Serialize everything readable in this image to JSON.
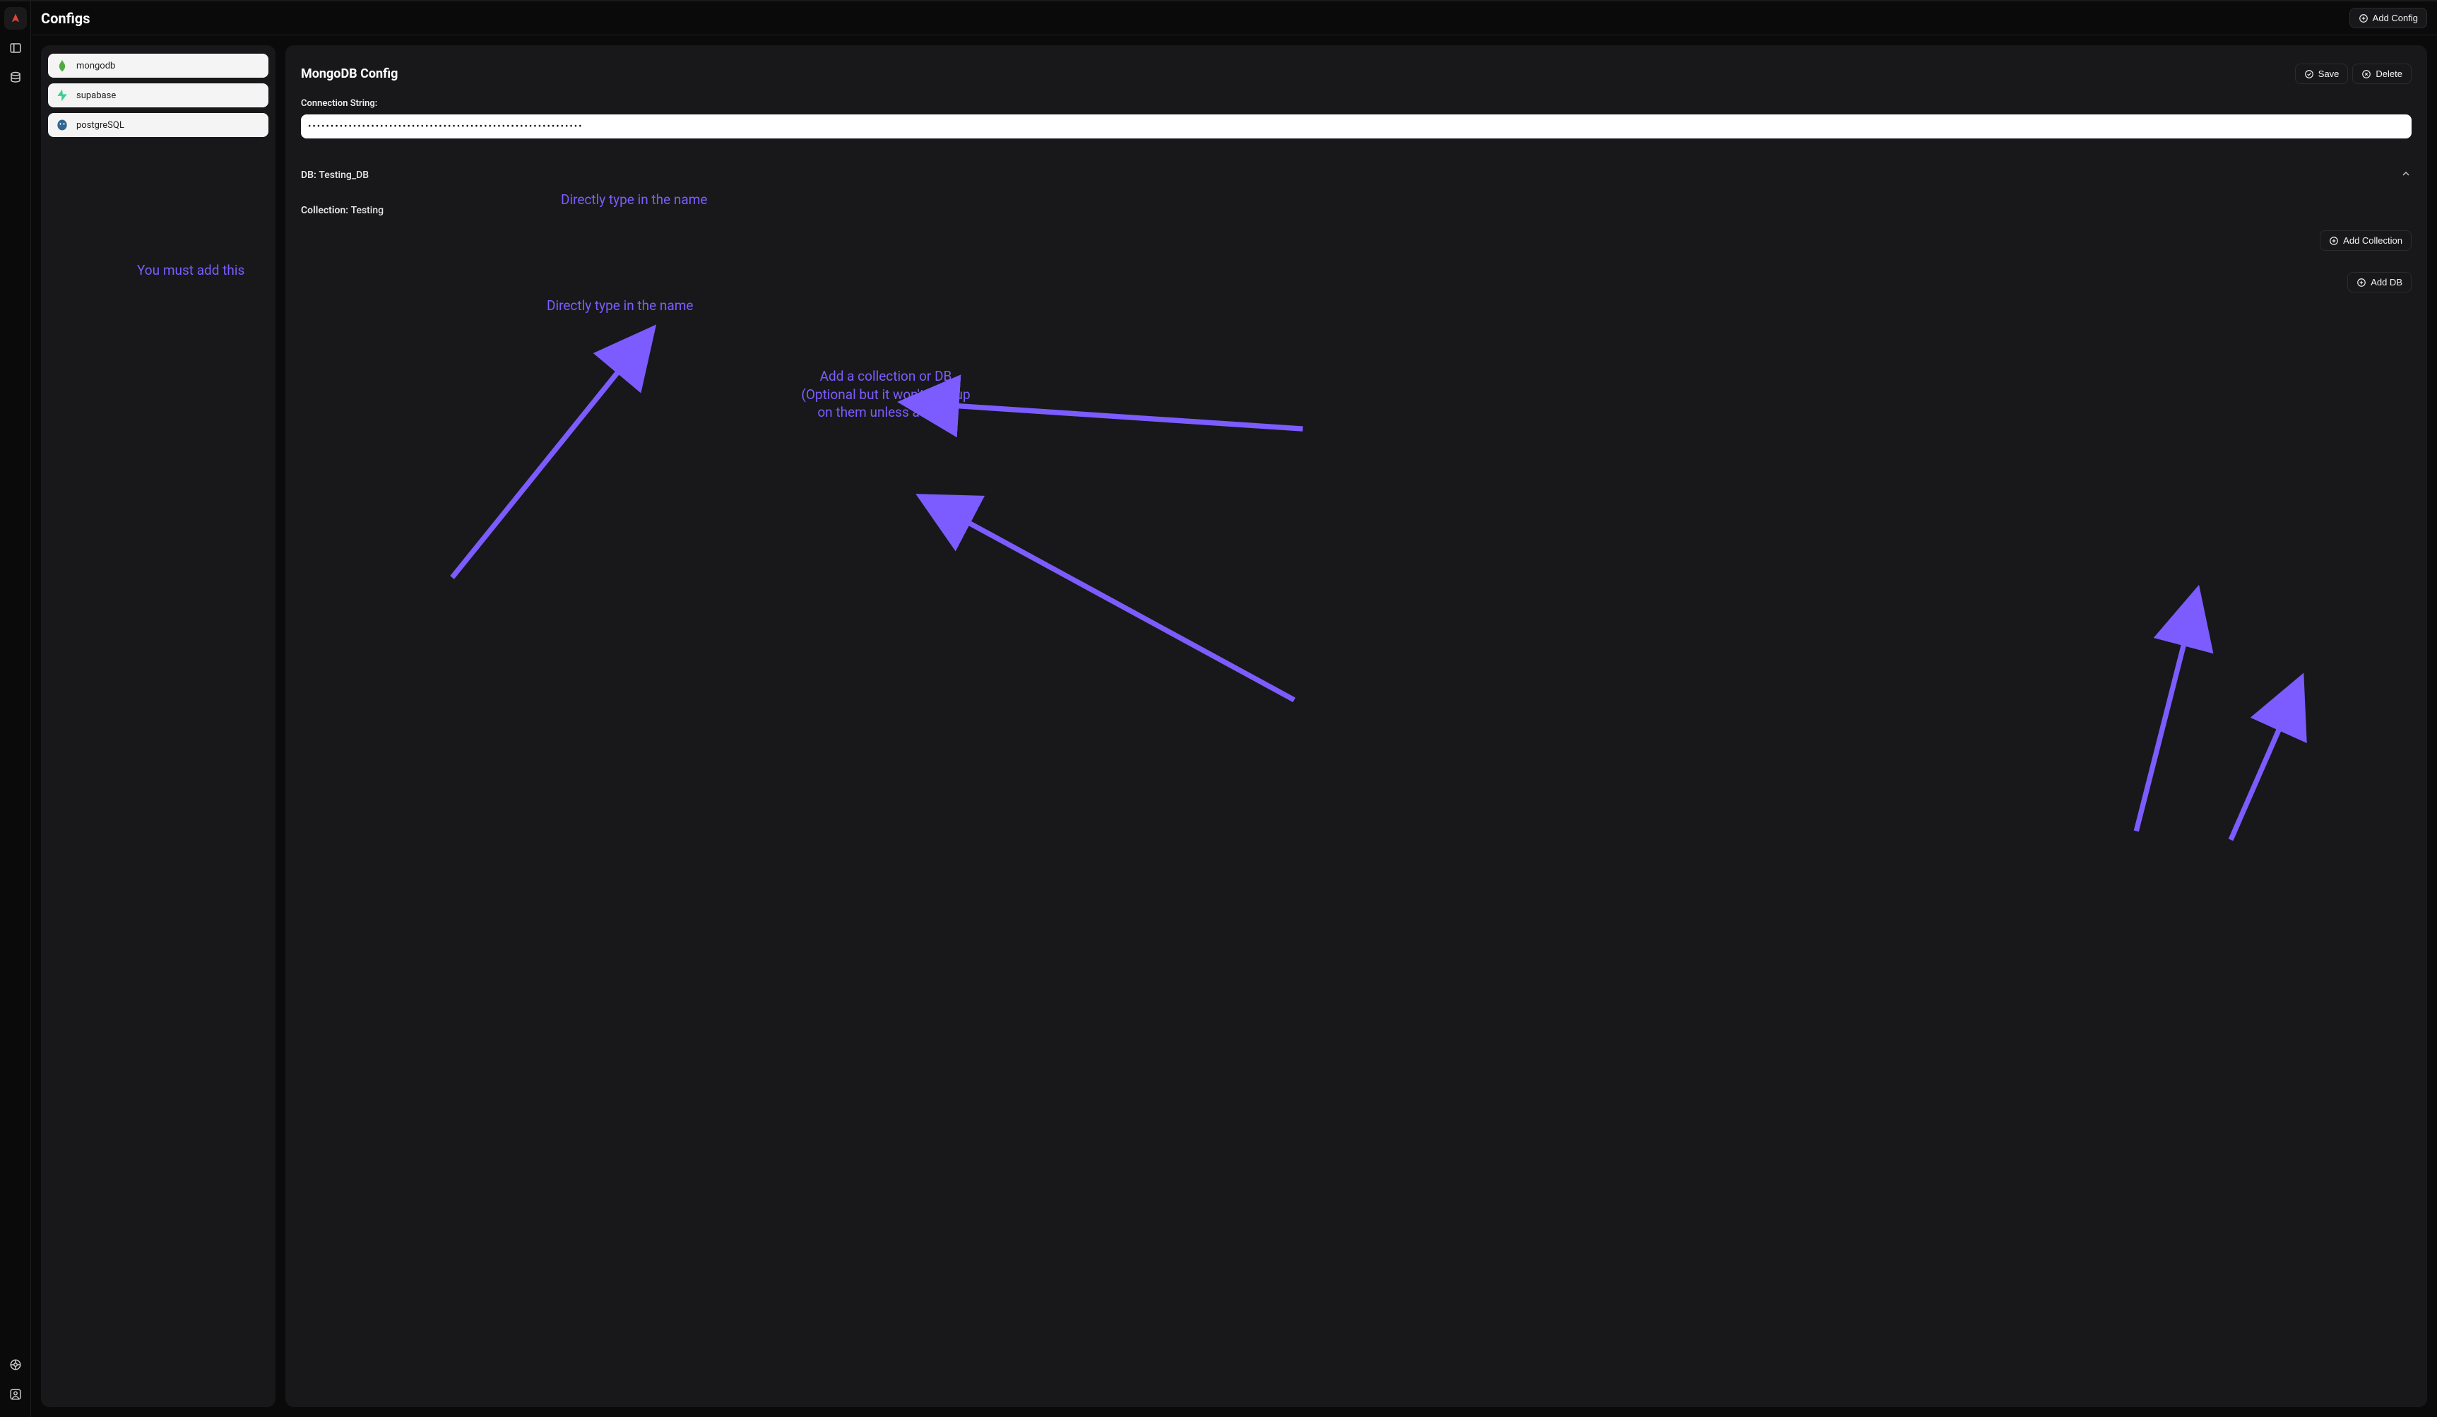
{
  "header": {
    "title": "Configs",
    "add_config_label": "Add Config"
  },
  "rail": {
    "logo": "app-logo",
    "items": [
      "panel-icon",
      "database-icon"
    ],
    "bottom_items": [
      "help-icon",
      "profile-icon"
    ]
  },
  "config_list": {
    "items": [
      {
        "id": "mongodb",
        "label": "mongodb",
        "icon": "mongodb"
      },
      {
        "id": "supabase",
        "label": "supabase",
        "icon": "supabase"
      },
      {
        "id": "postgresql",
        "label": "postgreSQL",
        "icon": "postgres"
      }
    ]
  },
  "detail": {
    "title": "MongoDB Config",
    "save_label": "Save",
    "delete_label": "Delete",
    "connection_label": "Connection String:",
    "connection_value": "•••••••••••••••••••••••••••••••••••••••••••••••••••••••••••••",
    "db_prefix": "DB: ",
    "db_value": "Testing_DB",
    "collection_prefix": "Collection: ",
    "collection_value": "Testing",
    "add_collection_label": "Add Collection",
    "add_db_label": "Add DB"
  },
  "annotations": {
    "must_add": "You must add this",
    "type_name_1": "Directly type in the name",
    "type_name_2": "Directly type in the name",
    "add_optional": "Add a collection or DB\n(Optional but it won't pick up\non them unless added)"
  }
}
